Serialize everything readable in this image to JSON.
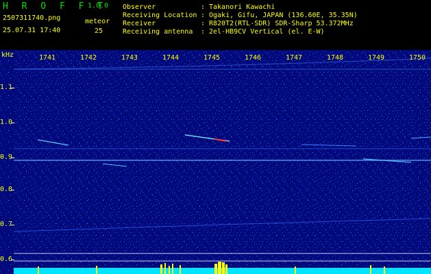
{
  "header": {
    "app_name": "H R O F F T",
    "version": "1.0.0",
    "filename": "2507311740.png",
    "datetime": "25.07.31 17:40",
    "meteor_label": "meteor",
    "meteor_count": "25"
  },
  "station": {
    "rows": [
      {
        "label": "Observer",
        "sep": ":",
        "value": "Takanori Kawachi"
      },
      {
        "label": "Receiving Location",
        "sep": ":",
        "value": "Ogaki, Gifu, JAPAN (136.60E, 35.35N)"
      },
      {
        "label": "Receiver",
        "sep": ":",
        "value": "R820T2(RTL-SDR) SDR-Sharp 53.372MHz"
      },
      {
        "label": "Receiving antenna",
        "sep": ":",
        "value": "2el-HB9CV Vertical (el. E-W)"
      }
    ]
  },
  "spectrogram": {
    "y_unit": "kHz",
    "y_ticks": [
      "1.1",
      "1.0",
      "0.9",
      "0.8",
      "0.7",
      "0.6"
    ],
    "x_ticks": [
      "1741",
      "1742",
      "1743",
      "1744",
      "1745",
      "1746",
      "1747",
      "1748",
      "1749",
      "1750"
    ],
    "colors": {
      "background": "#000a7a",
      "noise": "#1e3cff",
      "trace": "#6fd4ff",
      "hot": "#ff3030",
      "bar": "#00e5ff",
      "bar_peak": "#ffff00"
    }
  }
}
